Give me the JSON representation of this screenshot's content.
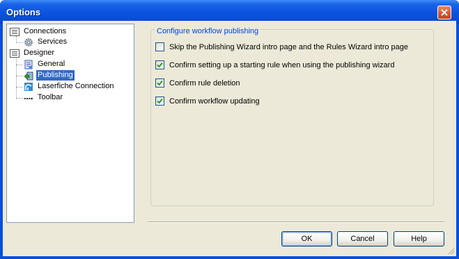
{
  "window": {
    "title": "Options"
  },
  "tree": {
    "items": [
      {
        "label": "Connections",
        "icon": "list-icon"
      },
      {
        "label": "Services",
        "icon": "gear-icon"
      },
      {
        "label": "Designer",
        "icon": "list-icon"
      },
      {
        "label": "General",
        "icon": "document-icon"
      },
      {
        "label": "Publishing",
        "icon": "publish-icon",
        "selected": true
      },
      {
        "label": "Laserfiche Connection",
        "icon": "connection-icon"
      },
      {
        "label": "Toolbar",
        "icon": "toolbar-icon"
      }
    ]
  },
  "group": {
    "title": "Configure workflow publishing",
    "options": [
      {
        "label": "Skip the Publishing Wizard intro page and the Rules Wizard intro page",
        "checked": false
      },
      {
        "label": "Confirm setting up a starting rule when using the publishing wizard",
        "checked": true
      },
      {
        "label": "Confirm rule deletion",
        "checked": true
      },
      {
        "label": "Confirm workflow updating",
        "checked": true
      }
    ]
  },
  "buttons": {
    "ok": "OK",
    "cancel": "Cancel",
    "help": "Help"
  },
  "colors": {
    "titlebar": "#0a53de",
    "selection": "#316ac5",
    "group_title": "#0046d5",
    "checkmark": "#21a121"
  }
}
